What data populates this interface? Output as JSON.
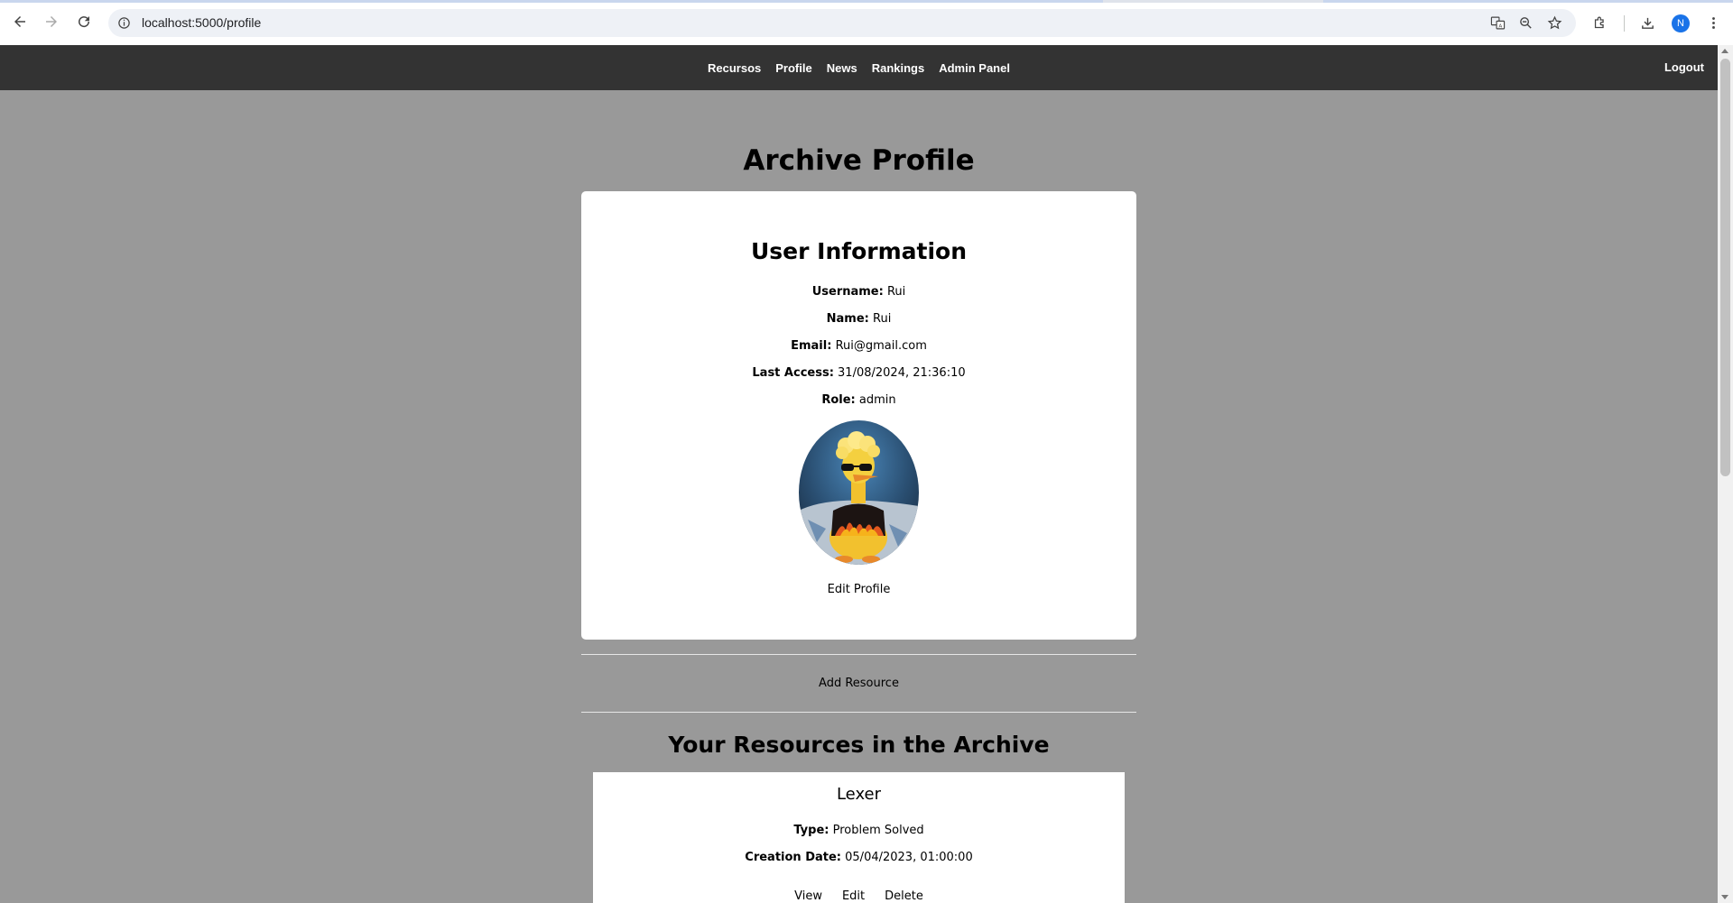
{
  "browser": {
    "url": "localhost:5000/profile",
    "profile_initial": "N"
  },
  "nav": {
    "links": [
      "Recursos",
      "Profile",
      "News",
      "Rankings",
      "Admin Panel"
    ],
    "logout": "Logout"
  },
  "page": {
    "title": "Archive Profile"
  },
  "user_info": {
    "heading": "User Information",
    "fields": [
      {
        "label": "Username:",
        "value": "Rui"
      },
      {
        "label": "Name:",
        "value": "Rui"
      },
      {
        "label": "Email:",
        "value": "Rui@gmail.com"
      },
      {
        "label": "Last Access:",
        "value": "31/08/2024, 21:36:10"
      },
      {
        "label": "Role:",
        "value": "admin"
      }
    ],
    "edit_label": "Edit Profile"
  },
  "actions": {
    "add_resource": "Add Resource"
  },
  "resources": {
    "heading": "Your Resources in the Archive",
    "items": [
      {
        "title": "Lexer",
        "type_label": "Type:",
        "type_value": "Problem Solved",
        "date_label": "Creation Date:",
        "date_value": "05/04/2023, 01:00:00",
        "view": "View",
        "edit": "Edit",
        "delete": "Delete"
      }
    ]
  },
  "colors": {
    "page_bg": "#999999",
    "nav_bg": "#333333",
    "card_bg": "#ffffff",
    "avatar_bg": "#1a73e8"
  }
}
